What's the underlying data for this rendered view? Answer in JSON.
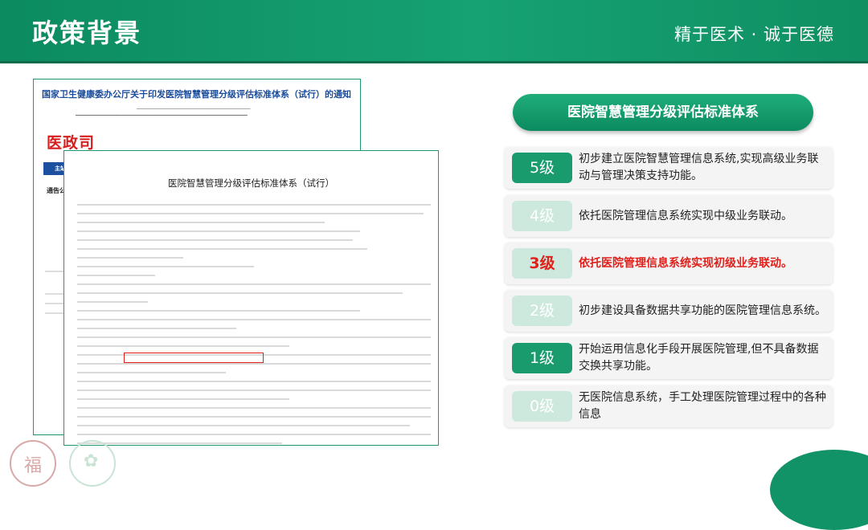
{
  "header": {
    "title": "政策背景",
    "slogan": "精于医术 · 诚于医德"
  },
  "doc1": {
    "heading": "国家卫生健康委办公厅关于印发医院智慧管理分级评估标准体系（试行）的通知",
    "logo": "医政司",
    "bar_label": "主站首页",
    "subheading": "通告公告"
  },
  "doc2": {
    "title": "医院智慧管理分级评估标准体系（试行）"
  },
  "panel_title": "医院智慧管理分级评估标准体系",
  "levels": [
    {
      "badge": "5级",
      "desc": "初步建立医院智慧管理信息系统,实现高级业务联动与管理决策支持功能。"
    },
    {
      "badge": "4级",
      "desc": "依托医院管理信息系统实现中级业务联动。"
    },
    {
      "badge": "3级",
      "desc": "依托医院管理信息系统实现初级业务联动。"
    },
    {
      "badge": "2级",
      "desc": "初步建设具备数据共享功能的医院管理信息系统。"
    },
    {
      "badge": "1级",
      "desc": "开始运用信息化手段开展医院管理,但不具备数据交换共享功能。"
    },
    {
      "badge": "0级",
      "desc": "无医院信息系统，手工处理医院管理过程中的各种信息"
    }
  ],
  "colors": {
    "brand_green": "#16a273",
    "highlight_red": "#e0201b"
  }
}
